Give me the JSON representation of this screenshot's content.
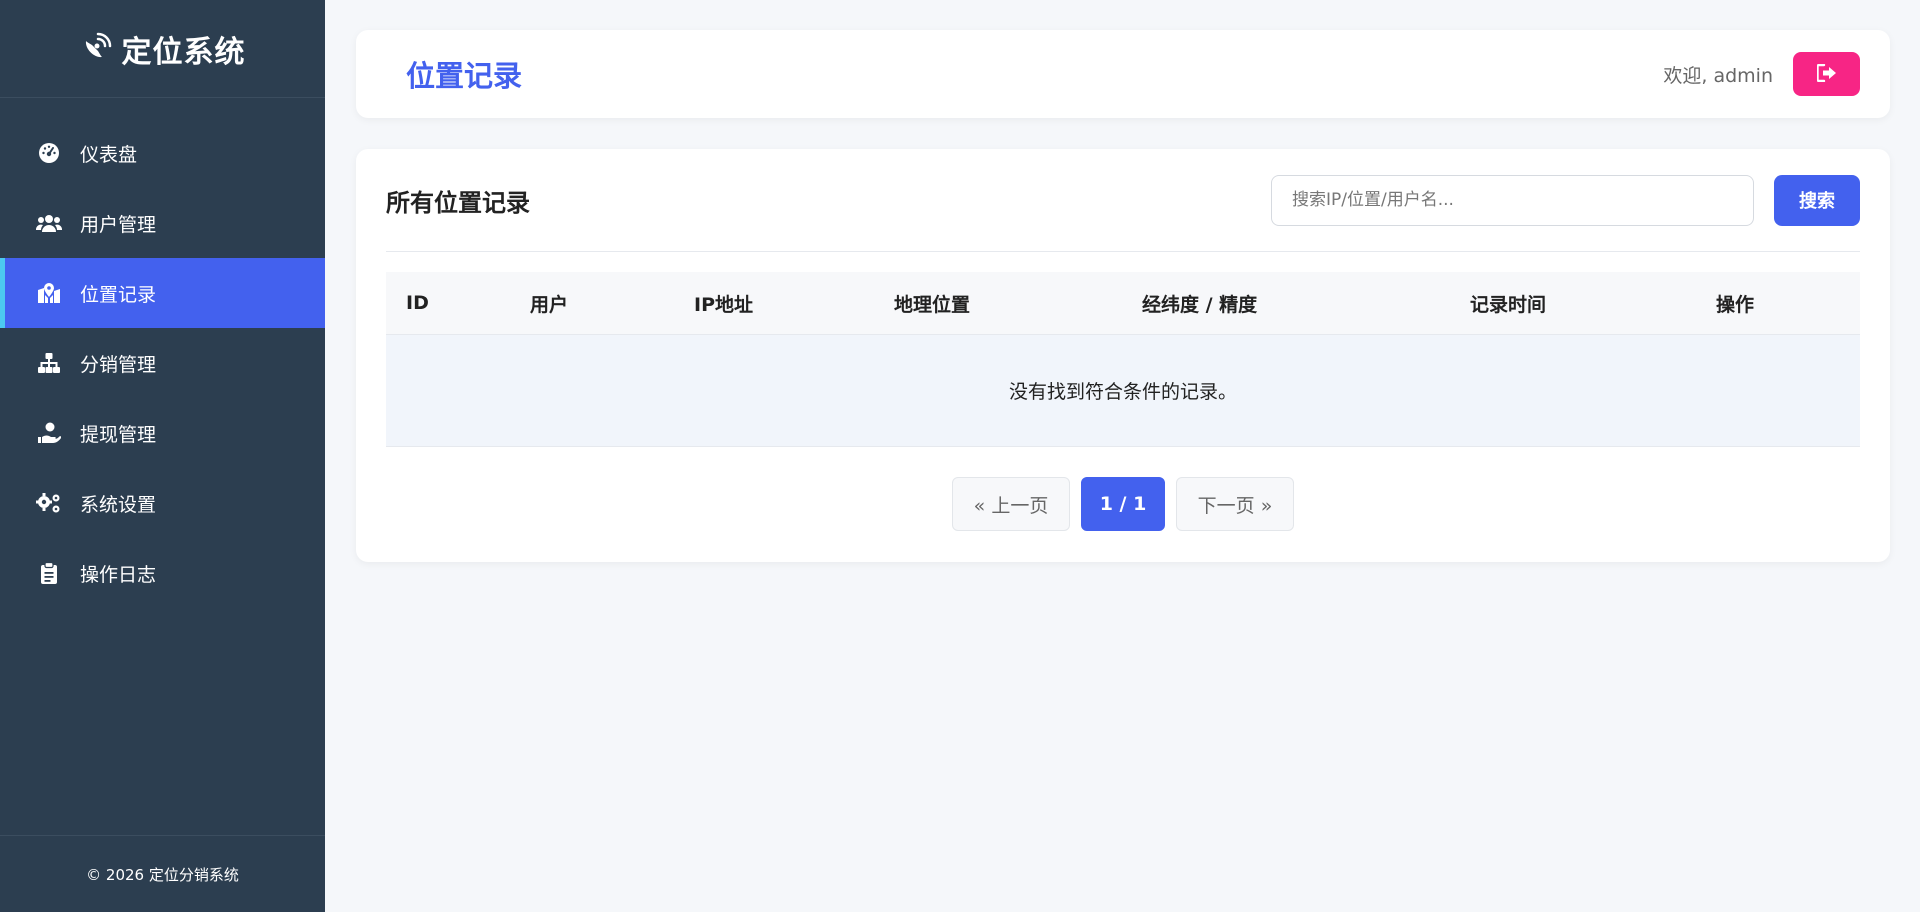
{
  "sidebar": {
    "brand": "定位系统",
    "items": [
      {
        "label": "仪表盘",
        "icon": "dashboard-icon"
      },
      {
        "label": "用户管理",
        "icon": "users-icon"
      },
      {
        "label": "位置记录",
        "icon": "map-location-icon"
      },
      {
        "label": "分销管理",
        "icon": "sitemap-icon"
      },
      {
        "label": "提现管理",
        "icon": "hand-money-icon"
      },
      {
        "label": "系统设置",
        "icon": "gears-icon"
      },
      {
        "label": "操作日志",
        "icon": "clipboard-icon"
      }
    ],
    "active_index": 2,
    "footer": "© 2026 定位分销系统"
  },
  "header": {
    "title": "位置记录",
    "welcome": "欢迎, admin",
    "logout_icon": "sign-out-icon"
  },
  "main": {
    "card_title": "所有位置记录",
    "search": {
      "placeholder": "搜索IP/位置/用户名...",
      "value": "",
      "button": "搜索"
    },
    "table": {
      "columns": [
        "ID",
        "用户",
        "IP地址",
        "地理位置",
        "经纬度 / 精度",
        "记录时间",
        "操作"
      ],
      "rows": [],
      "empty_message": "没有找到符合条件的记录。"
    },
    "pagination": {
      "prev": "« 上一页",
      "current": "1 / 1",
      "next": "下一页 »"
    }
  },
  "colors": {
    "sidebar_bg": "#2c3e50",
    "accent": "#4361ee",
    "active_marker": "#4cc9f0",
    "logout": "#f72585",
    "page_bg": "#f5f7fa"
  }
}
